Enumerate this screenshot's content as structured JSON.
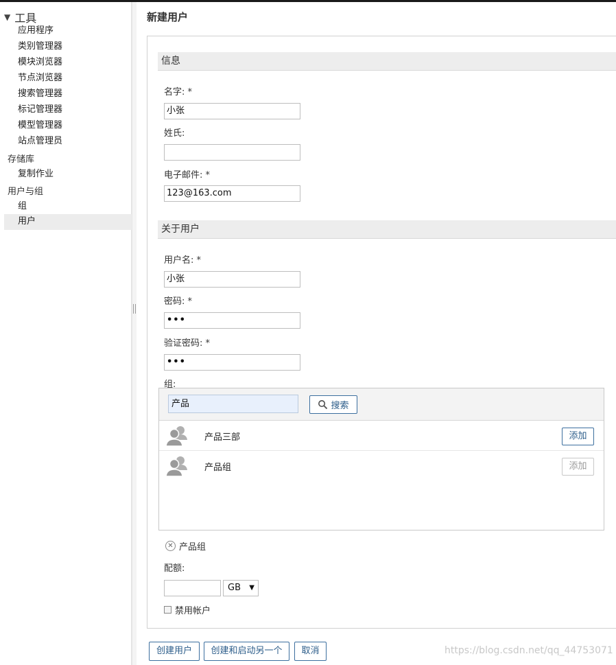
{
  "sidebar": {
    "root_label": "工具",
    "tools": [
      "应用程序",
      "类别管理器",
      "模块浏览器",
      "节点浏览器",
      "搜索管理器",
      "标记管理器",
      "模型管理器",
      "站点管理员"
    ],
    "repository_label": "存储库",
    "repository_items": [
      "复制作业"
    ],
    "users_groups_label": "用户与组",
    "users_groups_items": [
      "组",
      "用户"
    ]
  },
  "page": {
    "title": "新建用户"
  },
  "info": {
    "header": "信息",
    "first_name_label": "名字: *",
    "first_name_value": "小张",
    "last_name_label": "姓氏:",
    "last_name_value": "",
    "email_label": "电子邮件: *",
    "email_value": "123@163.com"
  },
  "about": {
    "header": "关于用户",
    "username_label": "用户名: *",
    "username_value": "小张",
    "password_label": "密码: *",
    "password_value": "•••",
    "confirm_label": "验证密码: *",
    "confirm_value": "•••",
    "groups_label": "组:"
  },
  "group_picker": {
    "search_value": "产品",
    "search_button": "搜索",
    "results": [
      {
        "name": "产品三部",
        "action": "添加"
      },
      {
        "name": "产品组",
        "action": "添加"
      }
    ],
    "selected": [
      "产品组"
    ]
  },
  "quota": {
    "label": "配额:",
    "value": "",
    "unit": "GB"
  },
  "disable": {
    "label": "禁用帐户"
  },
  "actions": {
    "create": "创建用户",
    "create_another": "创建和启动另一个",
    "cancel": "取消"
  },
  "watermark": "https://blog.csdn.net/qq_44753071"
}
